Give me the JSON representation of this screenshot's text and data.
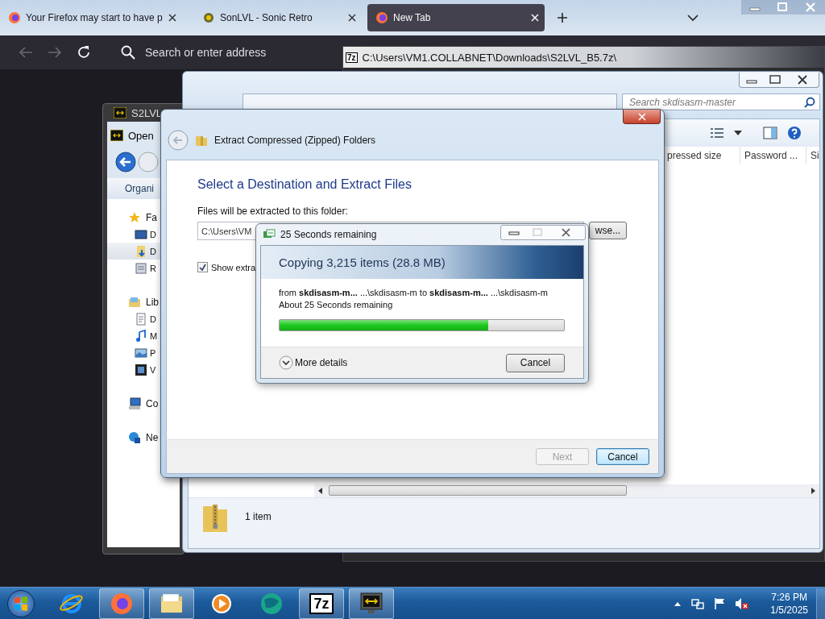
{
  "browser": {
    "tabs": [
      {
        "title": "Your Firefox may start to have p",
        "kind": "firefox",
        "selected": false
      },
      {
        "title": "SonLVL - Sonic Retro",
        "kind": "site",
        "selected": false
      },
      {
        "title": "New Tab",
        "kind": "firefox",
        "selected": true
      }
    ],
    "address_placeholder": "Search or enter address"
  },
  "archive_window": {
    "logo": "7z",
    "title": "C:\\Users\\VM1.COLLABNET\\Downloads\\S2LVL_B5.7z\\"
  },
  "explorer": {
    "search_placeholder": "Search skdisasm-master",
    "columns": [
      "pressed size",
      "Password ...",
      "Si"
    ],
    "status": "1 item"
  },
  "s2lvl_window": {
    "title": "S2LVL",
    "dialog_title": "Open",
    "toolbar": "Organi",
    "nav": [
      {
        "label": "Fa",
        "kind": "favorites",
        "selected": false,
        "children": [
          {
            "label": "D",
            "kind": "desktop",
            "selected": false
          },
          {
            "label": "D",
            "kind": "downloads",
            "selected": true
          },
          {
            "label": "R",
            "kind": "recent",
            "selected": false
          }
        ]
      },
      {
        "label": "Lib",
        "kind": "libraries",
        "selected": false,
        "children": [
          {
            "label": "D",
            "kind": "documents",
            "selected": false
          },
          {
            "label": "M",
            "kind": "music",
            "selected": false
          },
          {
            "label": "P",
            "kind": "pictures",
            "selected": false
          },
          {
            "label": "V",
            "kind": "videos",
            "selected": false
          }
        ]
      },
      {
        "label": "Co",
        "kind": "computer",
        "selected": false
      },
      {
        "label": "Ne",
        "kind": "network",
        "selected": false
      }
    ]
  },
  "extract_dialog": {
    "title": "Extract Compressed (Zipped) Folders",
    "heading": "Select a Destination and Extract Files",
    "folder_label": "Files will be extracted to this folder:",
    "folder_path": "C:\\Users\\VM",
    "browse": "wse...",
    "show_files": {
      "label": "Show extra",
      "checked": true
    },
    "buttons": [
      {
        "label": "Next",
        "disabled": true
      },
      {
        "label": "Cancel",
        "disabled": false
      }
    ]
  },
  "progress_dialog": {
    "title": "25 Seconds remaining",
    "heading": "Copying 3,215 items (28.8 MB)",
    "from_line": "from **skdisasm-m...** ...\\skdisasm-m to **skdisasm-m...** ...\\skdisasm-m",
    "time_line": "About 25 Seconds remaining",
    "level": 0.735,
    "details": "More details",
    "cancel": "Cancel"
  },
  "taskbar": {
    "apps": [
      {
        "kind": "browser-e",
        "active": false
      },
      {
        "kind": "firefox",
        "active": true
      },
      {
        "kind": "folder",
        "active": true
      },
      {
        "kind": "player",
        "active": false
      },
      {
        "kind": "sphere",
        "active": false
      },
      {
        "kind": "sevenzip",
        "label": "7z",
        "active": true
      },
      {
        "kind": "monitor",
        "active": true
      }
    ],
    "time": "7:26 PM",
    "date": "1/5/2025"
  }
}
